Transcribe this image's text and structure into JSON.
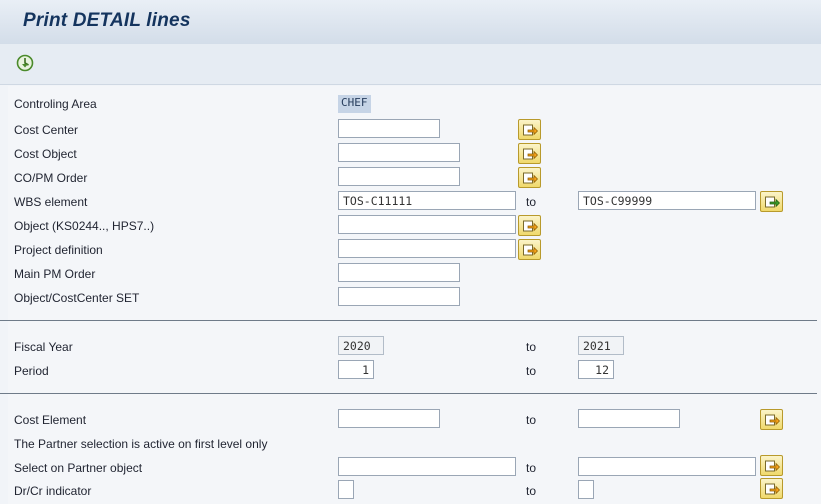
{
  "title": "Print DETAIL lines",
  "toolbar": {
    "execute_icon": "execute-clock-icon"
  },
  "controlling_area": {
    "label": "Controling Area",
    "value": "CHEF"
  },
  "cost_center": {
    "label": "Cost Center",
    "value": ""
  },
  "cost_object": {
    "label": "Cost Object",
    "value": ""
  },
  "co_pm_order": {
    "label": "CO/PM Order",
    "value": ""
  },
  "wbs_element": {
    "label": "WBS element",
    "from": "TOS-C11111",
    "to_label": "to",
    "to": "TOS-C99999"
  },
  "object": {
    "label": "Object (KS0244.., HPS7..)",
    "value": ""
  },
  "project_definition": {
    "label": "Project definition",
    "value": ""
  },
  "main_pm_order": {
    "label": "Main PM Order",
    "value": ""
  },
  "object_costcenter_set": {
    "label": "Object/CostCenter SET",
    "value": ""
  },
  "fiscal_year": {
    "label": "Fiscal Year",
    "from": "2020",
    "to_label": "to",
    "to": "2021"
  },
  "period": {
    "label": "Period",
    "from": "1",
    "to_label": "to",
    "to": "12"
  },
  "cost_element": {
    "label": "Cost Element",
    "from": "",
    "to_label": "to",
    "to": ""
  },
  "partner_note": "The Partner selection is active on first level only",
  "partner_object": {
    "label": "Select on Partner object",
    "from": "",
    "to_label": "to",
    "to": ""
  },
  "dr_cr": {
    "label": "Dr/Cr indicator",
    "from": "",
    "to_label": "to",
    "to": ""
  },
  "icons": {
    "multiple_selection": "multiple-selection-arrow-icon"
  },
  "colors": {
    "title": "#14345e",
    "button": "#f0d96c",
    "header": "#d3dde9"
  }
}
